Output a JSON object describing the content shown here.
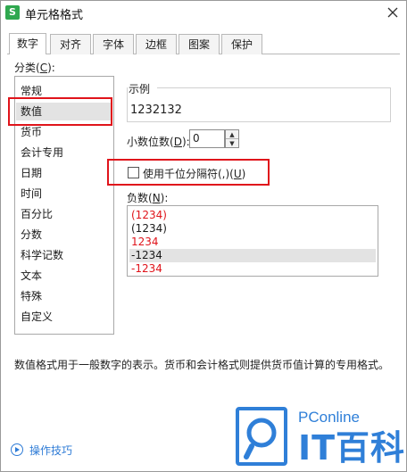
{
  "window": {
    "title": "单元格格式",
    "app_icon": "S"
  },
  "tabs": [
    {
      "label": "数字",
      "active": true
    },
    {
      "label": "对齐",
      "active": false
    },
    {
      "label": "字体",
      "active": false
    },
    {
      "label": "边框",
      "active": false
    },
    {
      "label": "图案",
      "active": false
    },
    {
      "label": "保护",
      "active": false
    }
  ],
  "category": {
    "label": "分类(",
    "hotkey": "C",
    "label_end": "):",
    "items": [
      "常规",
      "数值",
      "货币",
      "会计专用",
      "日期",
      "时间",
      "百分比",
      "分数",
      "科学记数",
      "文本",
      "特殊",
      "自定义"
    ],
    "selected": "数值"
  },
  "sample": {
    "label": "示例",
    "value": "1232132"
  },
  "decimal": {
    "label": "小数位数(",
    "hotkey": "D",
    "label_end": "):",
    "value": "0"
  },
  "thousands": {
    "label": "使用千位分隔符(,)(",
    "hotkey": "U",
    "label_end": ")",
    "checked": false
  },
  "negative": {
    "label": "负数(",
    "hotkey": "N",
    "label_end": "):",
    "items": [
      {
        "text": "(1234)",
        "color": "#e0141b"
      },
      {
        "text": "(1234)",
        "color": "#1a1a1a"
      },
      {
        "text": "1234",
        "color": "#e0141b"
      },
      {
        "text": "-1234",
        "color": "#1a1a1a"
      },
      {
        "text": "-1234",
        "color": "#e0141b"
      }
    ],
    "selected_index": 3
  },
  "description": "数值格式用于一般数字的表示。货币和会计格式则提供货币值计算的专用格式。",
  "footer": {
    "tips_label": "操作技巧"
  },
  "watermark": {
    "brand": "PConline",
    "name": "IT百科"
  },
  "colors": {
    "highlight_box": "#e0141b",
    "accent": "#2f7fd8",
    "app_icon": "#2fa84f"
  }
}
